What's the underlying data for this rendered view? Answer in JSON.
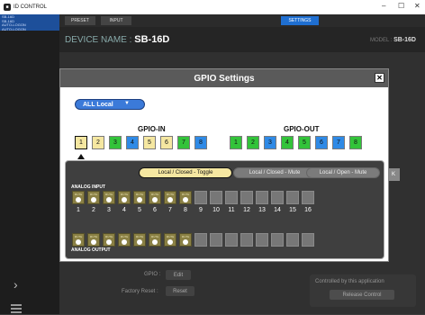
{
  "window": {
    "title": "ID CONTROL",
    "controls": [
      "–",
      "☐",
      "✕"
    ]
  },
  "sidebar": {
    "items": [
      {
        "lines": [
          "SB-16D",
          "SB-16D",
          "AUTO-LOGON",
          "AUTO-LOGON"
        ]
      }
    ]
  },
  "tabs": [
    {
      "label": "PRESET"
    },
    {
      "label": "INPUT"
    },
    {
      "label": "SETTINGS",
      "active": true
    }
  ],
  "device": {
    "label": "DEVICE NAME : ",
    "name": "SB-16D",
    "model_label": "MODEL : ",
    "model": "SB-16D"
  },
  "bottom": {
    "gpio_label": "GPIO :",
    "gpio_button": "Edit",
    "factory_label": "Factory Reset :",
    "factory_button": "Reset",
    "controlled_text": "Controlled by this application",
    "release_button": "Release Control",
    "side_button": "K"
  },
  "dialog": {
    "title": "GPIO Settings",
    "close": "✕",
    "dropdown_value": "ALL Local",
    "dropdown_caret": "▼",
    "gpio_in_title": "GPIO-IN",
    "gpio_out_title": "GPIO-OUT",
    "gpio_in": [
      {
        "label": "1",
        "color": "#f5e7a1",
        "selected": true
      },
      {
        "label": "2",
        "color": "#f5e7a1"
      },
      {
        "label": "3",
        "color": "#33c33a"
      },
      {
        "label": "4",
        "color": "#2f8ae6"
      },
      {
        "label": "5",
        "color": "#f5e7a1"
      },
      {
        "label": "6",
        "color": "#f5e7a1"
      },
      {
        "label": "7",
        "color": "#33c33a"
      },
      {
        "label": "8",
        "color": "#2f8ae6"
      }
    ],
    "gpio_out": [
      {
        "label": "1",
        "color": "#33c33a"
      },
      {
        "label": "2",
        "color": "#33c33a"
      },
      {
        "label": "3",
        "color": "#2f8ae6"
      },
      {
        "label": "4",
        "color": "#33c33a"
      },
      {
        "label": "5",
        "color": "#33c33a"
      },
      {
        "label": "6",
        "color": "#2f8ae6"
      },
      {
        "label": "7",
        "color": "#2f8ae6"
      },
      {
        "label": "8",
        "color": "#33c33a"
      }
    ],
    "modes": [
      {
        "label": "Local / Closed - Toggle",
        "active": true
      },
      {
        "label": "Local / Closed - Mute",
        "active": false
      },
      {
        "label": "Local / Open - Mute",
        "active": false
      }
    ],
    "analog_input_label": "ANALOG INPUT",
    "analog_output_label": "ANALOG OUTPUT",
    "mute_label": "MUTE",
    "channels": [
      "1",
      "2",
      "3",
      "4",
      "5",
      "6",
      "7",
      "8",
      "9",
      "10",
      "11",
      "12",
      "13",
      "14",
      "15",
      "16"
    ],
    "mute_count": 8
  }
}
